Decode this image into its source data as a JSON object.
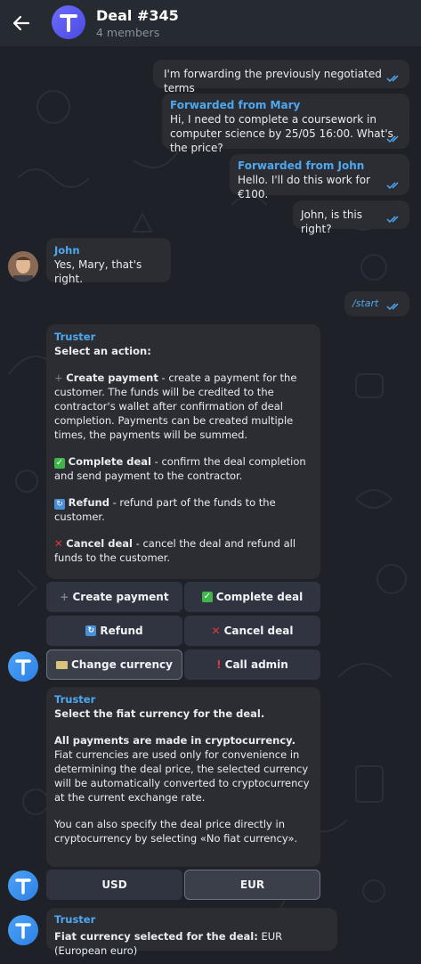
{
  "header": {
    "title": "Deal #345",
    "subtitle": "4 members"
  },
  "messages": {
    "m1": "I'm forwarding the previously negotiated terms",
    "m2_from": "Forwarded from Mary",
    "m2_text": "Hi, I need to complete a coursework in computer science by 25/05 16:00. What's the price?",
    "m3_from": "Forwarded from John",
    "m3_text": "Hello. I'll do this work for €100.",
    "m4": "John, is this right?",
    "m5_sender": "John",
    "m5_text": "Yes, Mary, that's right.",
    "m6": "/start"
  },
  "bot_menu": {
    "sender": "Truster",
    "title": "Select an action:",
    "create_label": "Create payment",
    "create_text": " - create a payment for the customer. The funds will be credited to the contractor's wallet after confirmation of deal completion. Payments can be created multiple times, the payments will be summed.",
    "complete_label": "Complete deal",
    "complete_text": " - confirm the deal completion and send payment to the contractor.",
    "refund_label": "Refund",
    "refund_text": " - refund part of the funds to the customer.",
    "cancel_label": "Cancel deal",
    "cancel_text": " - cancel the deal and refund all funds to the customer."
  },
  "keyboard1": {
    "create_payment": "Create payment",
    "complete_deal": "Complete deal",
    "refund": "Refund",
    "cancel_deal": "Cancel deal",
    "change_currency": "Change currency",
    "call_admin": "Call admin"
  },
  "currency_msg": {
    "sender": "Truster",
    "title": "Select the fiat currency for the deal.",
    "bold_part": "All payments are made in cryptocurrency.",
    "text_part": " Fiat currencies are used only for convenience in determining the deal price, the selected currency will be automatically converted to cryptocurrency at the current exchange rate.",
    "text2": "You can also specify the deal price directly in cryptocurrency by selecting «No fiat currency»."
  },
  "keyboard2": {
    "usd": "USD",
    "eur": "EUR"
  },
  "selected_msg": {
    "sender": "Truster",
    "label": "Fiat currency selected for the deal:",
    "value": " EUR (European euro)"
  },
  "colors": {
    "background": "#1e2127",
    "bubble": "#2b2d33",
    "accent": "#4ea8f0",
    "button": "#2f3440"
  }
}
